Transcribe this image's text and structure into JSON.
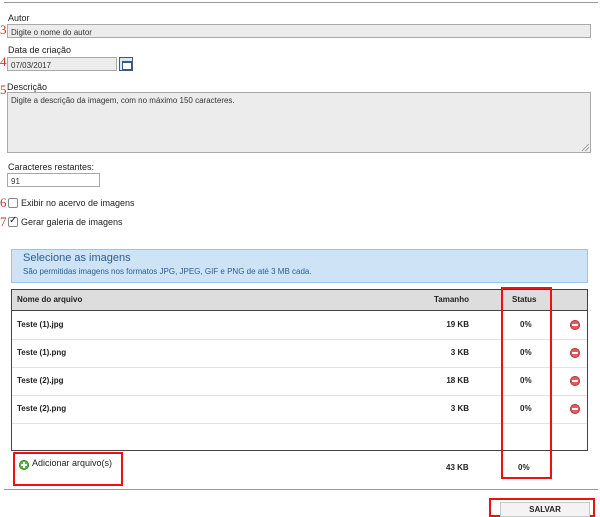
{
  "markers": [
    "3",
    "4",
    "5",
    "6",
    "7"
  ],
  "autor": {
    "label": "Autor",
    "placeholder": "Digite o nome do autor"
  },
  "data_criacao": {
    "label": "Data de criação",
    "value": "07/03/2017"
  },
  "descricao": {
    "label": "Descrição",
    "placeholder": "Digite a descrição da imagem, com no máximo 150 caracteres."
  },
  "caracteres": {
    "label": "Caracteres restantes:",
    "value": "91"
  },
  "exibir": {
    "label": "Exibir no acervo de imagens",
    "checked": false
  },
  "galeria": {
    "label": "Gerar galeria de imagens",
    "checked": true
  },
  "upload": {
    "title": "Selecione as imagens",
    "subtitle": "São permitidas imagens nos formatos JPG, JPEG, GIF e PNG de até 3 MB cada."
  },
  "table": {
    "headers": {
      "name": "Nome do arquivo",
      "size": "Tamanho",
      "status": "Status"
    },
    "rows": [
      {
        "name": "Teste (1).jpg",
        "size": "19 KB",
        "status": "0%"
      },
      {
        "name": "Teste (1).png",
        "size": "3 KB",
        "status": "0%"
      },
      {
        "name": "Teste (2).jpg",
        "size": "18 KB",
        "status": "0%"
      },
      {
        "name": "Teste (2).png",
        "size": "3 KB",
        "status": "0%"
      }
    ],
    "total": {
      "size": "43 KB",
      "status": "0%"
    }
  },
  "add_button": "Adicionar arquivo(s)",
  "save_button": "SALVAR",
  "colors": {
    "accent_red": "#e11",
    "panel_bg": "#cfe3f7",
    "panel_text": "#2a5e8f"
  }
}
